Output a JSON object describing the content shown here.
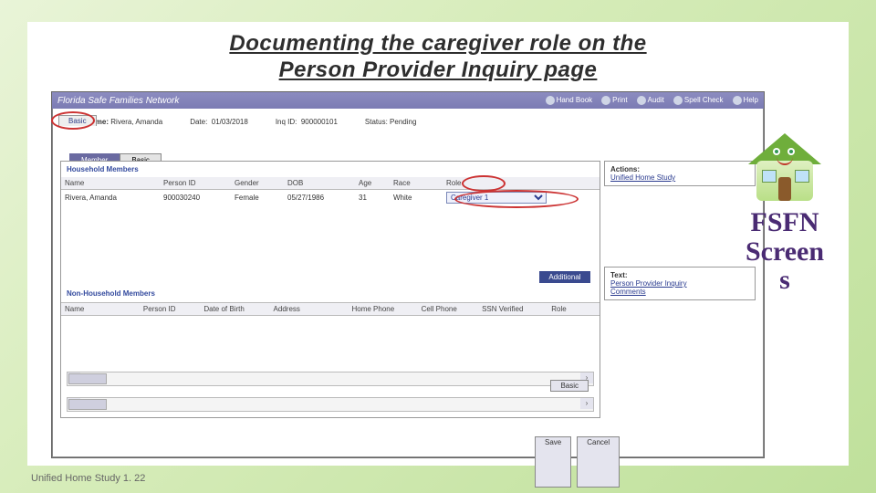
{
  "title_line1": "Documenting the caregiver role on the",
  "title_line2": "Person Provider Inquiry page",
  "footer": "Unified Home Study 1. 22",
  "right_widget": {
    "line1": "FSFN",
    "line2": "Screen",
    "line3": "s"
  },
  "app": {
    "name": "Florida Safe Families Network",
    "tools": {
      "handbook": "Hand Book",
      "print": "Print",
      "audit": "Audit",
      "spell": "Spell Check",
      "help": "Help"
    }
  },
  "tabs": {
    "basic": "Basic"
  },
  "info": {
    "familyLabel": "Family Name:",
    "familyValue": "Rivera, Amanda",
    "dateLabel": "Date:",
    "dateValue": "01/03/2018",
    "inqLabel": "Inq ID:",
    "inqValue": "900000101",
    "statusLabel": "Status:",
    "statusValue": "Pending"
  },
  "memberTabs": {
    "member": "Member",
    "basic": "Basic"
  },
  "panel": {
    "hhLabel": "Household Members",
    "nonHhLabel": "Non-Household Members",
    "addBtn": "Additional",
    "basicBtn": "Basic",
    "saveBtn": "Save",
    "cancelBtn": "Cancel",
    "hhCols": {
      "name": "Name",
      "pid": "Person ID",
      "gender": "Gender",
      "dob": "DOB",
      "age": "Age",
      "race": "Race",
      "role": "Role"
    },
    "hhRow": {
      "name": "Rivera, Amanda",
      "pid": "900030240",
      "gender": "Female",
      "dob": "05/27/1986",
      "age": "31",
      "race": "White",
      "role": "Caregiver 1"
    },
    "nhCols": {
      "name": "Name",
      "pid": "Person ID",
      "dob": "Date of Birth",
      "addr": "Address",
      "hphone": "Home Phone",
      "cphone": "Cell Phone",
      "ssn": "SSN Verified",
      "role": "Role"
    }
  },
  "side": {
    "actionsHd": "Actions:",
    "actionsLink": "Unified Home Study",
    "textHd": "Text:",
    "textLink1": "Person Provider Inquiry",
    "textLink2": "Comments"
  }
}
